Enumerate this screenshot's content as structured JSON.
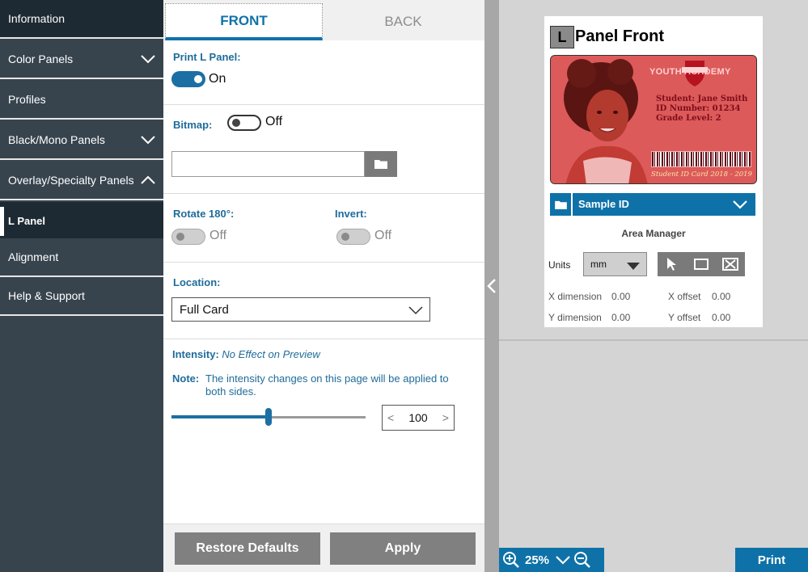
{
  "sidebar": {
    "items": [
      {
        "label": "Information"
      },
      {
        "label": "Color Panels"
      },
      {
        "label": "Profiles"
      },
      {
        "label": "Black/Mono Panels"
      },
      {
        "label": "Overlay/Specialty Panels"
      },
      {
        "label": "L Panel"
      },
      {
        "label": "Alignment"
      },
      {
        "label": "Help & Support"
      }
    ]
  },
  "tabs": {
    "front": "FRONT",
    "back": "BACK"
  },
  "print_panel": {
    "label": "Print L Panel:",
    "state": "On"
  },
  "bitmap": {
    "label": "Bitmap:",
    "state": "Off",
    "path_value": ""
  },
  "rotate": {
    "label": "Rotate 180°:",
    "state": "Off"
  },
  "invert": {
    "label": "Invert:",
    "state": "Off"
  },
  "location": {
    "label": "Location:",
    "value": "Full Card"
  },
  "intensity": {
    "label": "Intensity:",
    "hint": "No Effect on Preview",
    "note_label": "Note:",
    "note_text": "The intensity changes on this page will be applied to both sides.",
    "value": "100",
    "slider_fraction": 0.5,
    "dec": "<",
    "inc": ">"
  },
  "footer": {
    "restore": "Restore Defaults",
    "apply": "Apply"
  },
  "preview": {
    "badge": "L",
    "title": "Panel Front",
    "card": {
      "school": "YOUTH ACADEMY",
      "student": "Student: Jane Smith",
      "id_number": "ID Number: 01234",
      "grade": "Grade Level: 2",
      "footer": "Student ID Card 2018 - 2019"
    },
    "sample_label": "Sample ID",
    "area_manager": "Area Manager",
    "units_label": "Units",
    "units_value": "mm",
    "x_dim_label": "X dimension",
    "x_dim_value": "0.00",
    "y_dim_label": "Y dimension",
    "y_dim_value": "0.00",
    "x_off_label": "X offset",
    "x_off_value": "0.00",
    "y_off_label": "Y offset",
    "y_off_value": "0.00"
  },
  "bottom": {
    "zoom": "25%",
    "print": "Print"
  },
  "colors": {
    "accent": "#0e72a8",
    "sidebar": "#37444e",
    "sidebar_dark": "#1e2a33"
  }
}
